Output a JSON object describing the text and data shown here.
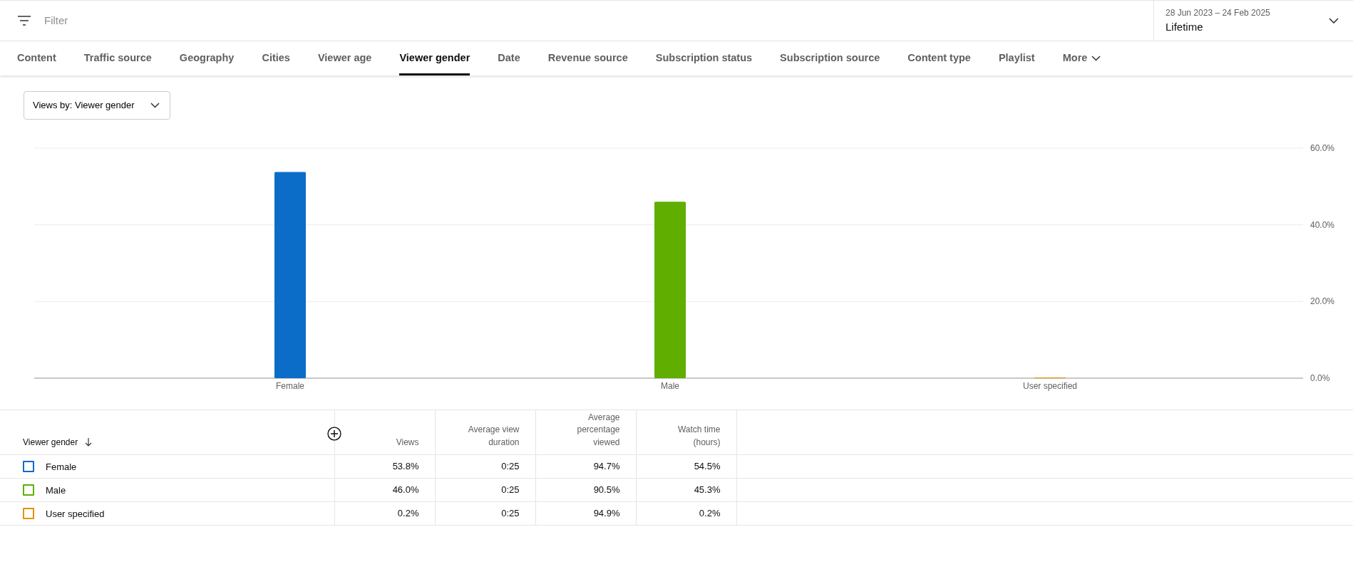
{
  "filter": {
    "placeholder": "Filter"
  },
  "date_range": {
    "range": "28 Jun 2023 – 24 Feb 2025",
    "period": "Lifetime"
  },
  "tabs": [
    {
      "label": "Content",
      "selected": false
    },
    {
      "label": "Traffic source",
      "selected": false
    },
    {
      "label": "Geography",
      "selected": false
    },
    {
      "label": "Cities",
      "selected": false
    },
    {
      "label": "Viewer age",
      "selected": false
    },
    {
      "label": "Viewer gender",
      "selected": true
    },
    {
      "label": "Date",
      "selected": false
    },
    {
      "label": "Revenue source",
      "selected": false
    },
    {
      "label": "Subscription status",
      "selected": false
    },
    {
      "label": "Subscription source",
      "selected": false
    },
    {
      "label": "Content type",
      "selected": false
    },
    {
      "label": "Playlist",
      "selected": false
    },
    {
      "label": "More",
      "selected": false,
      "kind": "menu"
    }
  ],
  "metric_dropdown": "Views by: Viewer gender",
  "chart_data": {
    "type": "bar",
    "categories": [
      "Female",
      "Male",
      "User specified"
    ],
    "values": [
      53.8,
      46.0,
      0.2
    ],
    "ylim": [
      0,
      60
    ],
    "yticks": [
      {
        "value": 0,
        "label": "0.0%"
      },
      {
        "value": 20,
        "label": "20.0%"
      },
      {
        "value": 40,
        "label": "40.0%"
      },
      {
        "value": 60,
        "label": "60.0%"
      }
    ]
  },
  "table": {
    "columns": [
      "Viewer gender",
      "Views",
      "Average view duration",
      "Average percentage viewed",
      "Watch time (hours)"
    ],
    "rows": [
      {
        "color": "#0b6dc8",
        "cells": [
          "Female",
          "53.8%",
          "0:25",
          "94.7%",
          "54.5%"
        ]
      },
      {
        "color": "#5fae00",
        "cells": [
          "Male",
          "46.0%",
          "0:25",
          "90.5%",
          "45.3%"
        ]
      },
      {
        "color": "#e09200",
        "cells": [
          "User specified",
          "0.2%",
          "0:25",
          "94.9%",
          "0.2%"
        ]
      }
    ]
  }
}
